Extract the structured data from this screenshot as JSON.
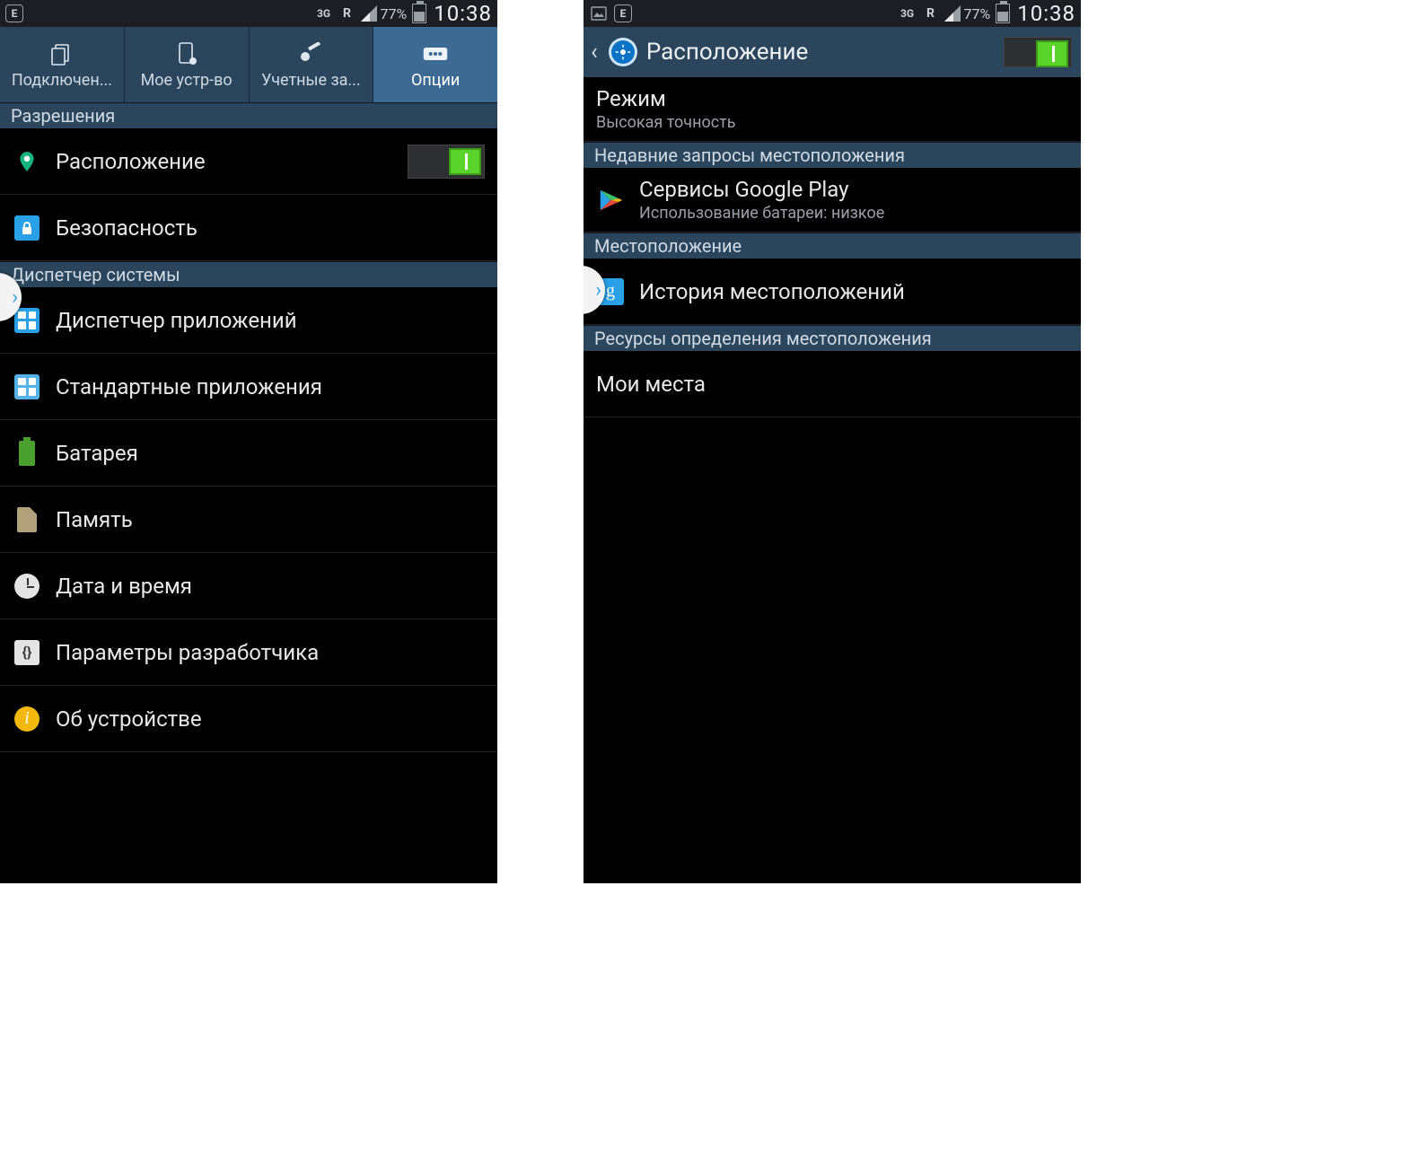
{
  "status": {
    "network": "3G",
    "roaming": "R",
    "battery_pct": "77%",
    "time": "10:38"
  },
  "left": {
    "tabs": [
      {
        "label": "Подключен...",
        "icon": "connections"
      },
      {
        "label": "Мое устр-во",
        "icon": "device"
      },
      {
        "label": "Учетные за...",
        "icon": "accounts"
      },
      {
        "label": "Опции",
        "icon": "more"
      }
    ],
    "sections": {
      "permissions_header": "Разрешения",
      "system_mgr_header": "Диспетчер системы"
    },
    "items": {
      "location": "Расположение",
      "security": "Безопасность",
      "app_mgr": "Диспетчер приложений",
      "default_apps": "Стандартные приложения",
      "battery": "Батарея",
      "storage": "Память",
      "date_time": "Дата и время",
      "dev_options": "Параметры разработчика",
      "about": "Об устройстве"
    }
  },
  "right": {
    "title": "Расположение",
    "mode": {
      "title": "Режим",
      "sub": "Высокая точность"
    },
    "recent_header": "Недавние запросы местоположения",
    "recent": {
      "title": "Сервисы Google Play",
      "sub": "Использование батареи: низкое"
    },
    "loc_header": "Местоположение",
    "history": "История местоположений",
    "sources_header": "Ресурсы определения местоположения",
    "my_places": "Мои места"
  }
}
